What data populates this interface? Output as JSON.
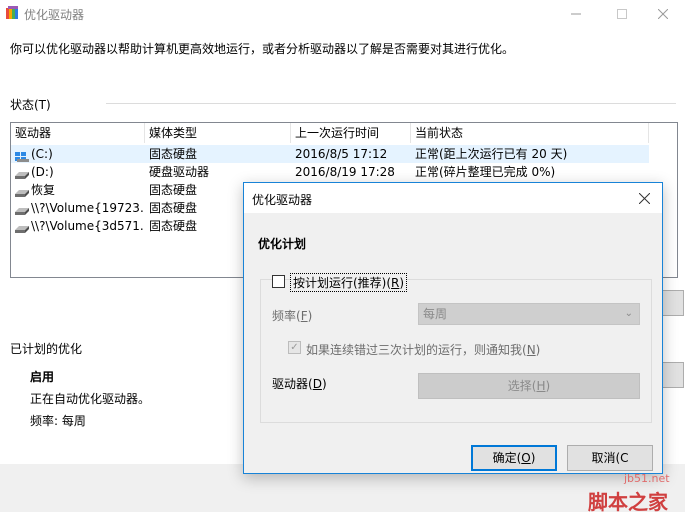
{
  "window": {
    "title": "优化驱动器",
    "description": "你可以优化驱动器以帮助计算机更高效地运行，或者分析驱动器以了解是否需要对其进行优化。"
  },
  "status": {
    "label": "状态(T)",
    "columns": [
      "驱动器",
      "媒体类型",
      "上一次运行时间",
      "当前状态"
    ],
    "rows": [
      {
        "drive": "(C:)",
        "media": "固态硬盘",
        "last_run": "2016/8/5 17:12",
        "status": "正常(距上次运行已有 20 天)",
        "icon": "system-drive-icon"
      },
      {
        "drive": "(D:)",
        "media": "硬盘驱动器",
        "last_run": "2016/8/19 17:28",
        "status": "正常(碎片整理已完成 0%)",
        "icon": "drive-icon"
      },
      {
        "drive": "恢复",
        "media": "固态硬盘",
        "last_run": "",
        "status": "",
        "icon": "drive-icon"
      },
      {
        "drive": "\\\\?\\Volume{19723...",
        "media": "固态硬盘",
        "last_run": "",
        "status": "",
        "icon": "drive-icon"
      },
      {
        "drive": "\\\\?\\Volume{3d571...",
        "media": "固态硬盘",
        "last_run": "",
        "status": "",
        "icon": "drive-icon"
      }
    ]
  },
  "scheduled": {
    "label": "已计划的优化",
    "enabled": "启用",
    "running": "正在自动优化驱动器。",
    "frequency": "频率: 每周"
  },
  "dialog": {
    "title": "优化驱动器",
    "heading": "优化计划",
    "run_on_schedule": {
      "text": "按计划运行(推荐)(",
      "key": "R",
      "end": ")",
      "checked": false
    },
    "frequency": {
      "text": "频率(",
      "key": "F",
      "end": ")",
      "value": "每周"
    },
    "notify": {
      "text": "如果连续错过三次计划的运行，则通知我(",
      "key": "N",
      "end": ")",
      "checked": true
    },
    "drives": {
      "text": "驱动器(",
      "key": "D",
      "end": ")"
    },
    "choose": {
      "text": "选择(",
      "key": "H",
      "end": ")"
    },
    "ok": {
      "text": "确定(",
      "key": "O",
      "end": ")"
    },
    "cancel": {
      "text": "取消(C"
    }
  },
  "watermark": {
    "url": "jb51.net",
    "text": "脚本之家"
  },
  "colors": {
    "accent": "#0078d7",
    "selection": "#e5f3ff",
    "dialog_border": "#1883d7"
  }
}
